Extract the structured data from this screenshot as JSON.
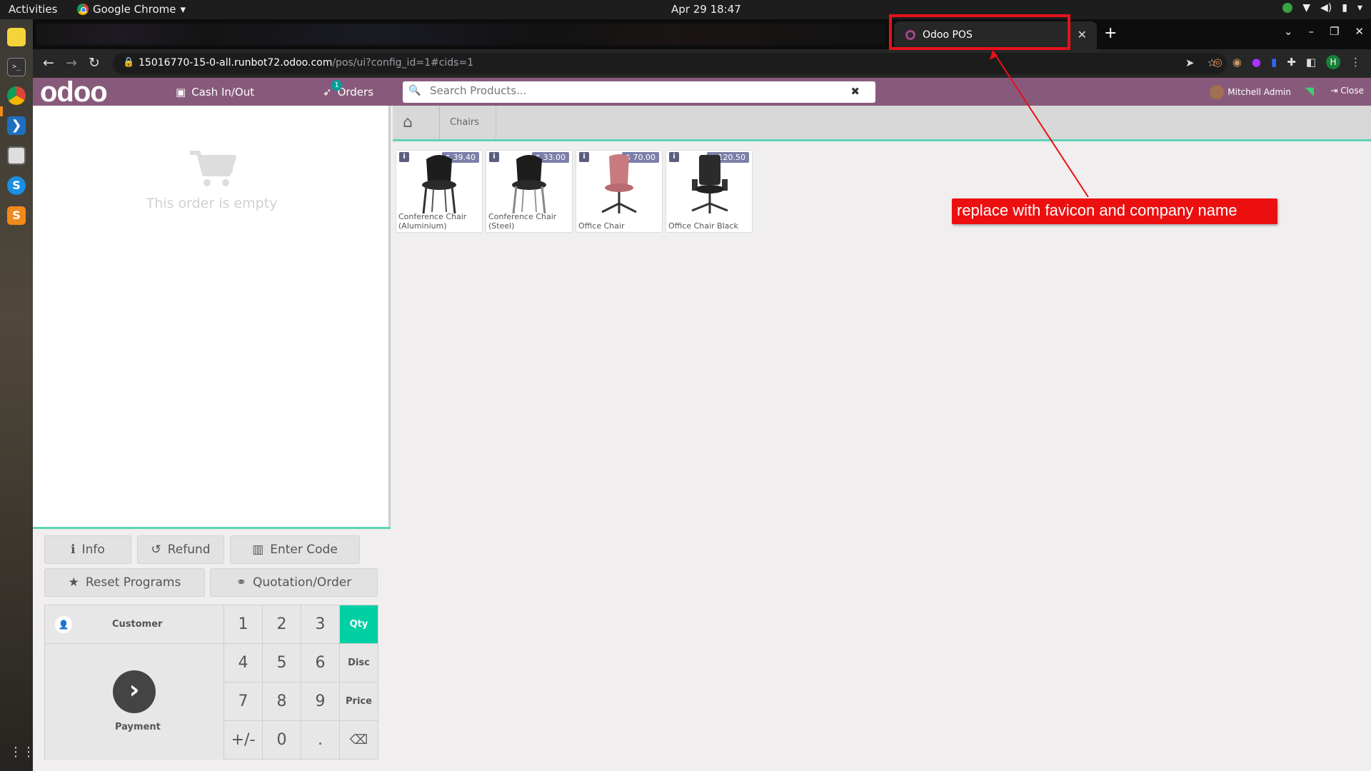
{
  "system_bar": {
    "activities": "Activities",
    "app_name": "Google Chrome",
    "clock": "Apr 29  18:47"
  },
  "browser": {
    "tab_title": "Odoo POS",
    "url_host": "15016770-15-0-all.runbot72.odoo.com",
    "url_path": "/pos/ui?config_id=1#cids=1",
    "profile_initial": "H"
  },
  "pos": {
    "logo": "odoo",
    "cash_label": "Cash In/Out",
    "orders_label": "Orders",
    "orders_count": "1",
    "search_placeholder": "Search Products...",
    "user_name": "Mitchell Admin",
    "close_label": "Close",
    "empty_text": "This order is empty",
    "breadcrumb": "Chairs",
    "buttons": {
      "info": "Info",
      "refund": "Refund",
      "enter_code": "Enter Code",
      "reset_programs": "Reset Programs",
      "quotation": "Quotation/Order",
      "customer": "Customer",
      "payment": "Payment"
    },
    "numpad": [
      "1",
      "2",
      "3",
      "4",
      "5",
      "6",
      "7",
      "8",
      "9",
      "+/-",
      "0",
      "."
    ],
    "modes": [
      "Qty",
      "Disc",
      "Price"
    ],
    "active_mode": "Qty",
    "products": [
      {
        "name_line1": "Conference Chair",
        "name_line2": "(Aluminium)",
        "price": "$ 39.40"
      },
      {
        "name_line1": "Conference Chair",
        "name_line2": "(Steel)",
        "price": "$ 33.00"
      },
      {
        "name_line1": "",
        "name_line2": "Office Chair",
        "price": "$ 70.00"
      },
      {
        "name_line1": "",
        "name_line2": "Office Chair Black",
        "price": "$ 120.50"
      }
    ]
  },
  "annotation": {
    "text": "replace with favicon and company name",
    "color": "#ec0f0f"
  },
  "colors": {
    "odoo_header": "#875a7b",
    "accent_teal": "#00d0a4",
    "price_tag": "#7b7fa9"
  }
}
